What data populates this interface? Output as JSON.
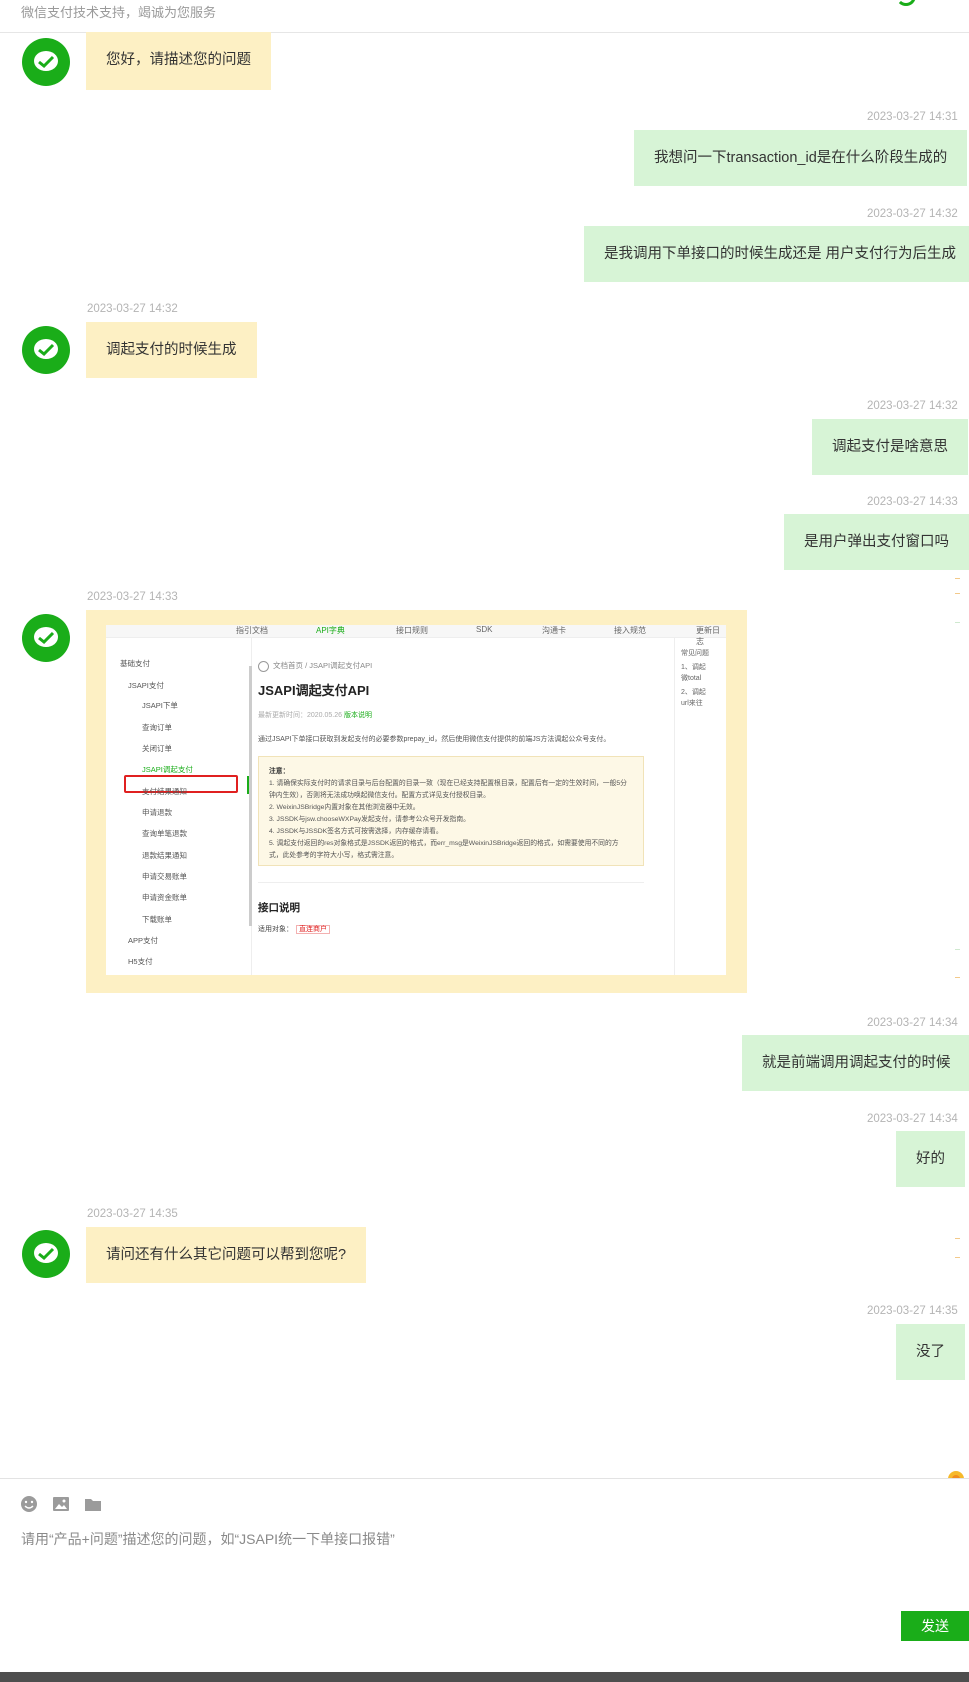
{
  "header": {
    "subtitle": "微信支付技术支持，竭诚为您服务"
  },
  "messages": [
    {
      "side": "left",
      "time": "",
      "text": "您好，请描述您的问题"
    },
    {
      "side": "right",
      "time": "2023-03-27 14:31",
      "text": "我想问一下transaction_id是在什么阶段生成的"
    },
    {
      "side": "right",
      "time": "2023-03-27 14:32",
      "text": "是我调用下单接口的时候生成还是 用户支付行为后生成"
    },
    {
      "side": "left",
      "time": "2023-03-27 14:32",
      "text": "调起支付的时候生成"
    },
    {
      "side": "right",
      "time": "2023-03-27 14:32",
      "text": "调起支付是啥意思"
    },
    {
      "side": "right",
      "time": "2023-03-27 14:33",
      "text": "是用户弹出支付窗口吗"
    },
    {
      "side": "left",
      "time": "2023-03-27 14:33",
      "text": ""
    },
    {
      "side": "right",
      "time": "2023-03-27 14:34",
      "text": "就是前端调用调起支付的时候"
    },
    {
      "side": "right",
      "time": "2023-03-27 14:34",
      "text": "好的"
    },
    {
      "side": "left",
      "time": "2023-03-27 14:35",
      "text": "请问还有什么其它问题可以帮到您呢?"
    },
    {
      "side": "right",
      "time": "2023-03-27 14:35",
      "text": "没了"
    }
  ],
  "screenshot": {
    "nav": [
      "指引文档",
      "API字典",
      "接口规则",
      "SDK",
      "沟通卡",
      "接入规范",
      "更新日志"
    ],
    "sidebar": [
      "基础支付",
      "JSAPI支付",
      "JSAPI下单",
      "查询订单",
      "关闭订单",
      "JSAPI调起支付",
      "支付结果通知",
      "申请退款",
      "查询单笔退款",
      "退款结果通知",
      "申请交易账单",
      "申请资金账单",
      "下载账单",
      "APP支付",
      "H5支付"
    ],
    "breadcrumb": "文档首页 / JSAPI调起支付API",
    "title": "JSAPI调起支付API",
    "updated_label": "最新更新时间：2020.05.26",
    "updated_link": "版本说明",
    "intro": "通过JSAPI下单接口获取到发起支付的必要参数prepay_id，然后使用微信支付提供的前端JS方法调起公众号支付。",
    "note_title": "注意：",
    "note_lines": [
      "1. 请确保实际支付时的请求目录与后台配置的目录一致（现在已经支持配置根目录，配置后有一定的生效时间，一般5分",
      "钟内生效），否则将无法成功唤起微信支付。配置方式详见支付授权目录。",
      "2. WeixinJSBridge内置对象在其他浏览器中无效。",
      "3. JSSDK与jsw.chooseWXPay发起支付，请参考公众号开发指南。",
      "4. JSSDK与JSSDK签名方式可按需选择，内存缓存请看。",
      "5. 调起支付返回的res对象格式是JSSDK返回的格式，而err_msg是WeixinJSBridge返回的格式，如需要使用不同的方",
      "式，此处参考的字符大小写，格式需注意。"
    ],
    "section": "接口说明",
    "fit_label": "适用对象：",
    "fit_value": "直连商户",
    "right_panel": [
      "常见问题",
      "1、调起",
      "微total",
      "2、调起",
      "url来往"
    ]
  },
  "composer": {
    "placeholder": "请用“产品+问题”描述您的问题，如“JSAPI统一下单接口报错”",
    "send_label": "发送",
    "tools": [
      "emoji-icon",
      "image-icon",
      "folder-icon"
    ]
  },
  "colors": {
    "brand": "#1aad19",
    "agent_bubble": "#fdf0c4",
    "user_bubble": "#d7f4d6"
  }
}
